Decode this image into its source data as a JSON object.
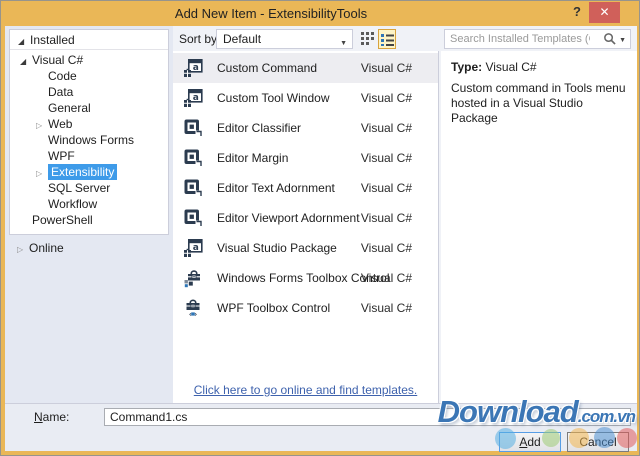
{
  "window": {
    "title": "Add New Item - ExtensibilityTools",
    "help_label": "?",
    "close_label": "✕"
  },
  "toolbar": {
    "sort_label": "Sort by:",
    "sort_value": "Default",
    "search_placeholder": "Search Installed Templates (Ctrl+E)"
  },
  "sidebar": {
    "installed_label": "Installed",
    "online_label": "Online",
    "tree": [
      {
        "label": "Visual C#",
        "level": 0,
        "arrow": "expanded",
        "selected": false
      },
      {
        "label": "Code",
        "level": 1,
        "arrow": "none",
        "selected": false
      },
      {
        "label": "Data",
        "level": 1,
        "arrow": "none",
        "selected": false
      },
      {
        "label": "General",
        "level": 1,
        "arrow": "none",
        "selected": false
      },
      {
        "label": "Web",
        "level": 1,
        "arrow": "collapsed",
        "selected": false
      },
      {
        "label": "Windows Forms",
        "level": 1,
        "arrow": "none",
        "selected": false
      },
      {
        "label": "WPF",
        "level": 1,
        "arrow": "none",
        "selected": false
      },
      {
        "label": "Extensibility",
        "level": 1,
        "arrow": "collapsed",
        "selected": true
      },
      {
        "label": "SQL Server",
        "level": 1,
        "arrow": "none",
        "selected": false
      },
      {
        "label": "Workflow",
        "level": 1,
        "arrow": "none",
        "selected": false
      },
      {
        "label": "PowerShell",
        "level": 0,
        "arrow": "none",
        "selected": false
      }
    ]
  },
  "templates": {
    "items": [
      {
        "name": "Custom Command",
        "lang": "Visual C#",
        "icon": "command"
      },
      {
        "name": "Custom Tool Window",
        "lang": "Visual C#",
        "icon": "command"
      },
      {
        "name": "Editor Classifier",
        "lang": "Visual C#",
        "icon": "editor"
      },
      {
        "name": "Editor Margin",
        "lang": "Visual C#",
        "icon": "editor"
      },
      {
        "name": "Editor Text Adornment",
        "lang": "Visual C#",
        "icon": "editor"
      },
      {
        "name": "Editor Viewport Adornment",
        "lang": "Visual C#",
        "icon": "editor"
      },
      {
        "name": "Visual Studio Package",
        "lang": "Visual C#",
        "icon": "command"
      },
      {
        "name": "Windows Forms Toolbox Control",
        "lang": "Visual C#",
        "icon": "toolbox-wf"
      },
      {
        "name": "WPF Toolbox Control",
        "lang": "Visual C#",
        "icon": "toolbox-wpf"
      }
    ],
    "online_link": "Click here to go online and find templates."
  },
  "details": {
    "type_label": "Type:",
    "type_value": "Visual C#",
    "description": "Custom command in Tools menu hosted in a Visual Studio Package"
  },
  "footer": {
    "name_label_mnemonic": "N",
    "name_label_rest": "ame:",
    "name_value": "Command1.cs",
    "add_mnemonic": "A",
    "add_rest": "dd",
    "cancel_label": "Cancel"
  },
  "watermark": {
    "main": "Download",
    "suffix": ".com.vn"
  },
  "colors": {
    "titlebar_gold": "#EAB757",
    "close_red": "#D0605A",
    "selection_blue": "#3E9BE9",
    "link_blue": "#3E62AD",
    "watermark_blue": "#3B76B5",
    "view_button_highlight": "#FDF4C6"
  }
}
